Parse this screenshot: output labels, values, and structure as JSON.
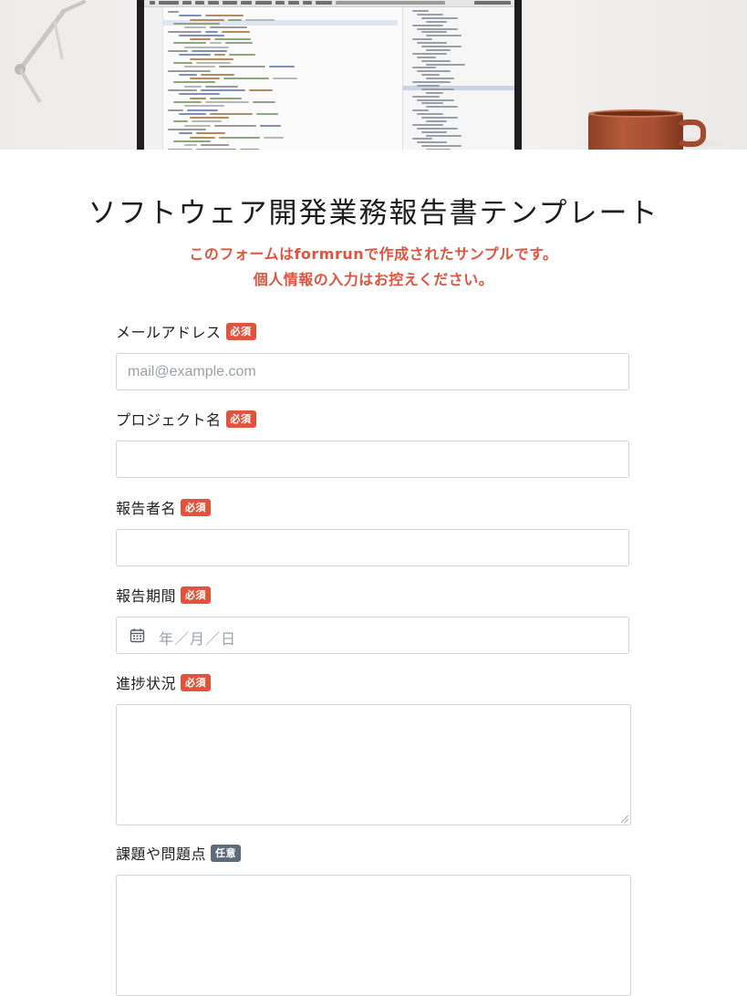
{
  "form": {
    "title": "ソフトウェア開発業務報告書テンプレート",
    "notice_line1": "このフォームはformrunで作成されたサンプルです。",
    "notice_line2": "個人情報の入力はお控えください。"
  },
  "badges": {
    "required": "必須",
    "optional": "任意"
  },
  "fields": [
    {
      "label": "メールアドレス",
      "type": "email",
      "placeholder": "mail@example.com",
      "value": "",
      "required": true
    },
    {
      "label": "プロジェクト名",
      "type": "text",
      "placeholder": "",
      "value": "",
      "required": true
    },
    {
      "label": "報告者名",
      "type": "text",
      "placeholder": "",
      "value": "",
      "required": true
    },
    {
      "label": "報告期間",
      "type": "date",
      "placeholder": "年／月／日",
      "value": "",
      "required": true,
      "icon": "calendar-icon"
    },
    {
      "label": "進捗状況",
      "type": "textarea",
      "placeholder": "",
      "value": "",
      "required": true
    },
    {
      "label": "課題や問題点",
      "type": "textarea",
      "placeholder": "",
      "value": "",
      "required": false
    }
  ],
  "colors": {
    "accent": "#e0533d",
    "required_badge": "#e0533d",
    "optional_badge": "#5d6b7b",
    "input_border": "#cfd4da",
    "placeholder": "#9aa0a6"
  }
}
